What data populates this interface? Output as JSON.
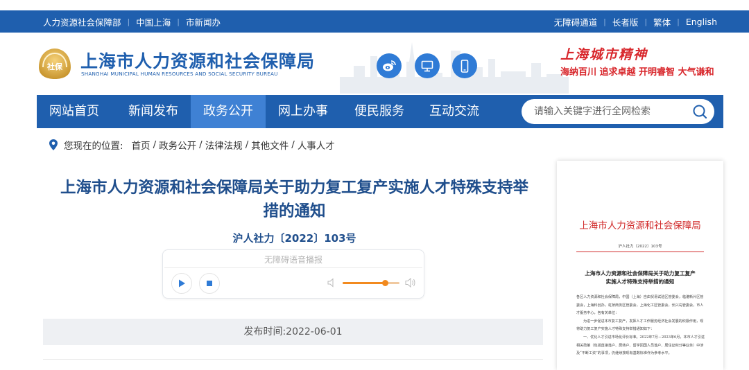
{
  "topbar": {
    "left_links": [
      "人力资源社会保障部",
      "中国上海",
      "市新闻办"
    ],
    "right_links": [
      "无障碍通道",
      "长者版",
      "繁体",
      "English"
    ]
  },
  "header": {
    "logo_emblem_text": "社保",
    "logo_cn": "上海市人力资源和社会保障局",
    "logo_en": "SHANGHAI MUNICIPAL HUMAN RESOURCES AND SOCIAL SECURITY BUREAU",
    "icons": [
      "weibo-icon",
      "desktop-icon",
      "mobile-icon"
    ],
    "spirit_title": "上海城市精神",
    "spirit_sub": "海纳百川  追求卓越  开明睿智  大气谦和"
  },
  "nav": {
    "items": [
      "网站首页",
      "新闻发布",
      "政务公开",
      "网上办事",
      "便民服务",
      "互动交流"
    ],
    "active_index": 2,
    "search_placeholder": "请输入关键字进行全网检索"
  },
  "breadcrumb": {
    "label": "您现在的位置:",
    "items": [
      "首页",
      "政务公开",
      "法律法规",
      "其他文件",
      "人事人才"
    ]
  },
  "article": {
    "title_line1": "上海市人力资源和社会保障局关于助力复工复产实施人才特殊支持举",
    "title_line2": "措的通知",
    "doc_number": "沪人社力〔2022〕103号",
    "audio_label": "无障碍语音播报",
    "volume_level": 0.75,
    "publish_label": "发布时间:",
    "publish_date": "2022-06-01"
  },
  "document_preview": {
    "org": "上海市人力资源和社会保障局",
    "doc_number": "沪人社力〔2022〕103号",
    "title_line1": "上海市人力资源和社会保障局关于助力复工复产",
    "title_line2": "实施人才特殊支持举措的通知",
    "body": [
      "各区人力资源和社会保障局，中国（上海）自由贸易试验区管委会，临港新片区管委会，上海科创办，虹桥商务区管委会，上海化工区管委会，长兴岛管委会，市人才服务中心，各有关单位：",
      "为进一步促进本市复工复产，发挥人才工作服务经济社会发展的积极作用，现将助力复工复产实施人才特殊支持举措通知如下：",
      "一、优化人才引进市场化评价标准。2022年7月－2023年6月，本市人才引进相关政策（包括直接落户、居转户、留学回国人员落户、居住证积分等业务）中涉及“不断工资”的事项，仍继续按现有基数标准作为参考水平。"
    ]
  }
}
